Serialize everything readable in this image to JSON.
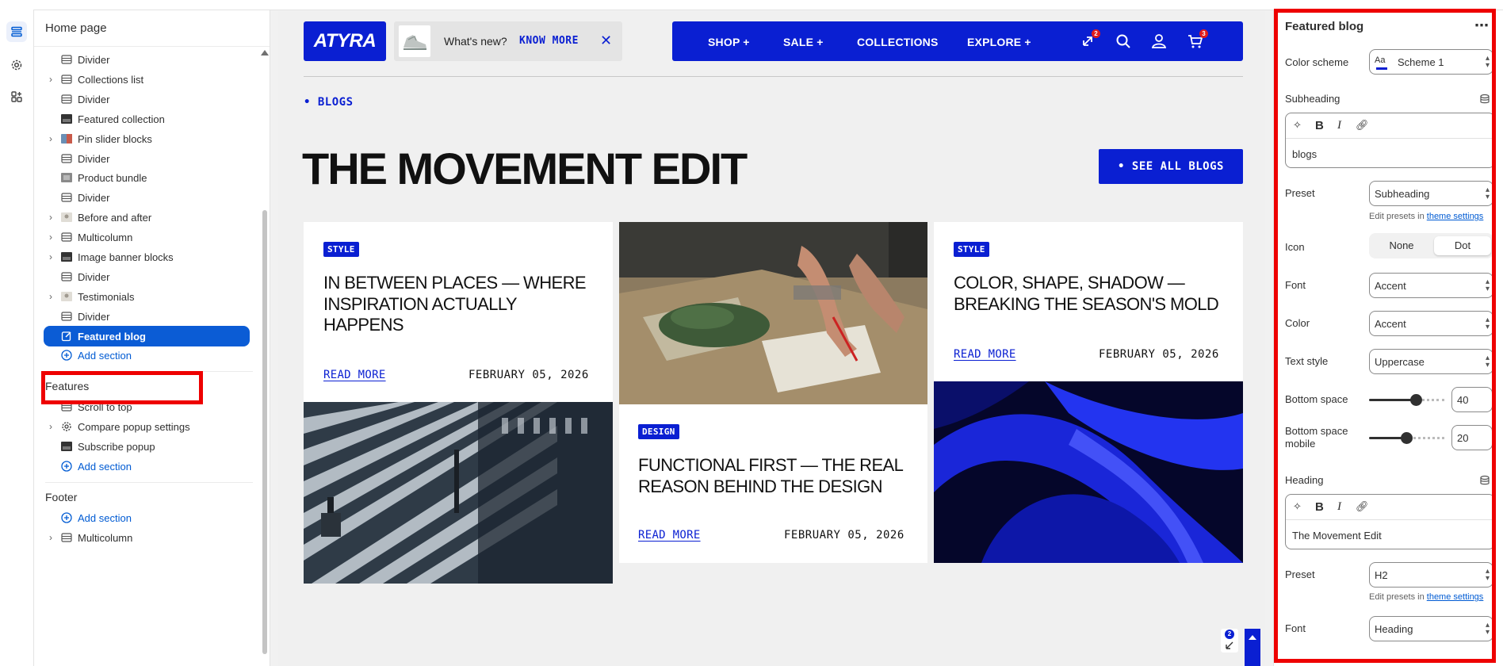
{
  "sidebar": {
    "title": "Home page",
    "items": [
      {
        "label": "Divider",
        "chevron": false,
        "icon": "divider"
      },
      {
        "label": "Collections list",
        "chevron": true,
        "icon": "divider"
      },
      {
        "label": "Divider",
        "chevron": false,
        "icon": "divider"
      },
      {
        "label": "Featured collection",
        "chevron": false,
        "icon": "image"
      },
      {
        "label": "Pin slider blocks",
        "chevron": true,
        "icon": "image-color"
      },
      {
        "label": "Divider",
        "chevron": false,
        "icon": "divider"
      },
      {
        "label": "Product bundle",
        "chevron": false,
        "icon": "image-gray"
      },
      {
        "label": "Divider",
        "chevron": false,
        "icon": "divider"
      },
      {
        "label": "Before and after",
        "chevron": true,
        "icon": "image-light"
      },
      {
        "label": "Multicolumn",
        "chevron": true,
        "icon": "divider"
      },
      {
        "label": "Image banner blocks",
        "chevron": true,
        "icon": "image"
      },
      {
        "label": "Divider",
        "chevron": false,
        "icon": "divider"
      },
      {
        "label": "Testimonials",
        "chevron": true,
        "icon": "image-light"
      },
      {
        "label": "Divider",
        "chevron": false,
        "icon": "divider"
      }
    ],
    "selected": "Featured blog",
    "add_section": "Add section",
    "features_heading": "Features",
    "features": [
      {
        "label": "Scroll to top",
        "chevron": false,
        "icon": "divider"
      },
      {
        "label": "Compare popup settings",
        "chevron": true,
        "icon": "gear"
      },
      {
        "label": "Subscribe popup",
        "chevron": false,
        "icon": "image"
      }
    ],
    "features_add": "Add section",
    "footer_heading": "Footer",
    "footer_add": "Add section",
    "footer_items": [
      {
        "label": "Multicolumn",
        "chevron": true,
        "icon": "divider"
      }
    ]
  },
  "preview": {
    "logo": "ATYRA",
    "promo_text": "What's new?",
    "promo_link": "KNOW MORE",
    "nav": [
      "SHOP +",
      "SALE +",
      "COLLECTIONS",
      "EXPLORE +"
    ],
    "compare_badge": "2",
    "cart_badge": "3",
    "subheading": "• BLOGS",
    "heading": "THE MOVEMENT EDIT",
    "see_all": "• SEE ALL BLOGS",
    "cards": [
      {
        "tag": "STYLE",
        "title": "IN BETWEEN PLACES — WHERE INSPIRATION ACTUALLY HAPPENS",
        "read_more": "READ MORE",
        "date": "FEBRUARY 05, 2026"
      },
      {
        "tag": "DESIGN",
        "title": "FUNCTIONAL FIRST — THE REAL REASON BEHIND THE DESIGN",
        "read_more": "READ MORE",
        "date": "FEBRUARY 05, 2026"
      },
      {
        "tag": "STYLE",
        "title": "COLOR, SHAPE, SHADOW — BREAKING THE SEASON'S MOLD",
        "read_more": "READ MORE",
        "date": "FEBRUARY 05, 2026"
      }
    ],
    "widget_badge": "2"
  },
  "panel": {
    "title": "Featured blog",
    "color_scheme_label": "Color scheme",
    "color_scheme_value": "Scheme 1",
    "color_scheme_icon_text": "Aa",
    "subheading_label": "Subheading",
    "subheading_value": "blogs",
    "preset_label": "Preset",
    "preset_value": "Subheading",
    "hint_prefix": "Edit presets in ",
    "hint_link": "theme settings",
    "icon_label": "Icon",
    "icon_options": [
      "None",
      "Dot"
    ],
    "icon_selected": "Dot",
    "font_label": "Font",
    "font_value": "Accent",
    "color_label": "Color",
    "color_value": "Accent",
    "text_style_label": "Text style",
    "text_style_value": "Uppercase",
    "bottom_space_label": "Bottom space",
    "bottom_space_value": "40",
    "bottom_space_mobile_label": "Bottom space mobile",
    "bottom_space_mobile_value": "20",
    "heading_label": "Heading",
    "heading_value": "The Movement Edit",
    "preset2_label": "Preset",
    "preset2_value": "H2",
    "hint2_prefix": "Edit presets in ",
    "hint2_link": "theme settings",
    "font2_label": "Font",
    "font2_value": "Heading"
  },
  "colors": {
    "brand_blue": "#0a1fd2",
    "selection_blue": "#0b5cd5",
    "highlight_red": "#ee0000"
  }
}
